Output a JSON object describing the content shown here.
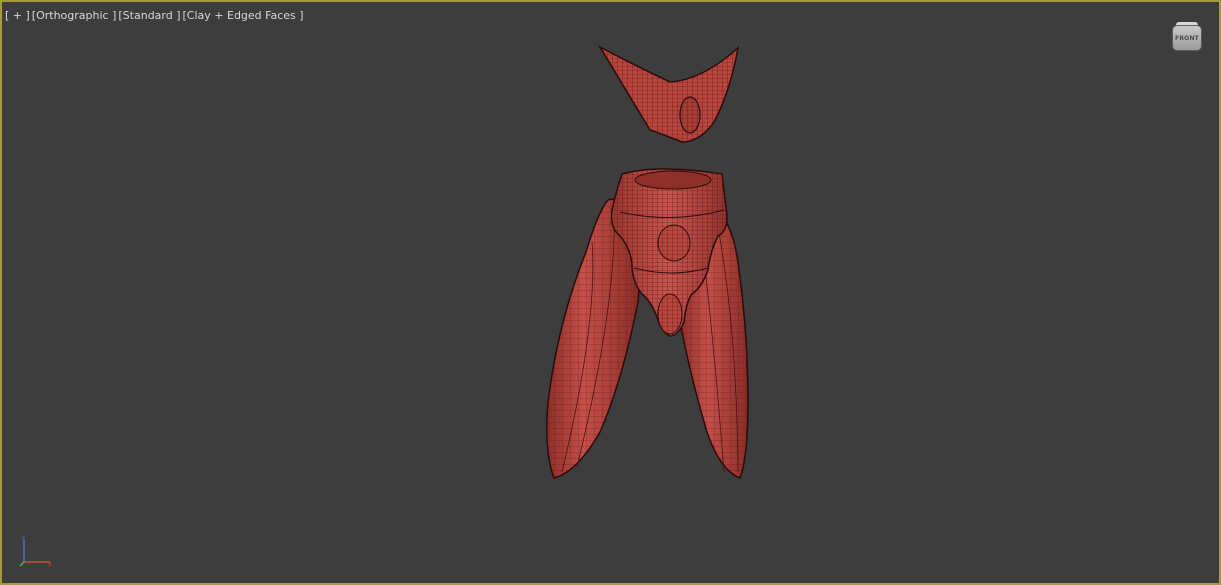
{
  "viewport": {
    "labels": [
      "[ + ]",
      "[Orthographic ]",
      "[Standard ]",
      "[Clay + Edged Faces ]"
    ],
    "border_color": "#a59a3c",
    "background_color": "#3d3d3d"
  },
  "viewcube": {
    "face_label": "FRONT",
    "icon": "viewcube-icon"
  },
  "model": {
    "color": "#b8463f",
    "wire_color": "#4a1412",
    "parts": [
      "mask-shoulder-piece",
      "torso",
      "left-arm",
      "right-arm"
    ]
  },
  "axis_tripod": {
    "icon": "axis-tripod-icon",
    "colors": {
      "x": "#d04a3a",
      "y": "#3fbf3f",
      "z": "#4a6ed0"
    }
  }
}
